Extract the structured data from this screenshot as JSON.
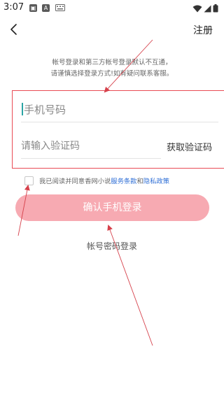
{
  "status_bar": {
    "time": "3:07",
    "icons": [
      "app-notification-icon",
      "a-notification-icon",
      "keyboard-icon",
      "wifi-icon",
      "signal-icon",
      "battery-icon"
    ]
  },
  "nav": {
    "back_icon": "chevron-left-icon",
    "register_label": "注册"
  },
  "notice": {
    "line1": "帐号登录和第三方帐号登录默认不互通，",
    "line2": "请谨慎选择登录方式!如有疑问联系客服。"
  },
  "form": {
    "phone_placeholder": "手机号码",
    "code_placeholder": "请输入验证码",
    "get_code_label": "获取验证码"
  },
  "agreement": {
    "prefix": "我已阅读并同意香网小说",
    "terms_link": "服务条款",
    "connector": "和",
    "privacy_link": "隐私政策"
  },
  "login_button_label": "确认手机登录",
  "alt_login_label": "帐号密码登录",
  "colors": {
    "highlight_box": "#e94b55",
    "annotation_arrow": "#d6414b",
    "login_button": "#f7aab2",
    "link": "#2f6fd6"
  }
}
